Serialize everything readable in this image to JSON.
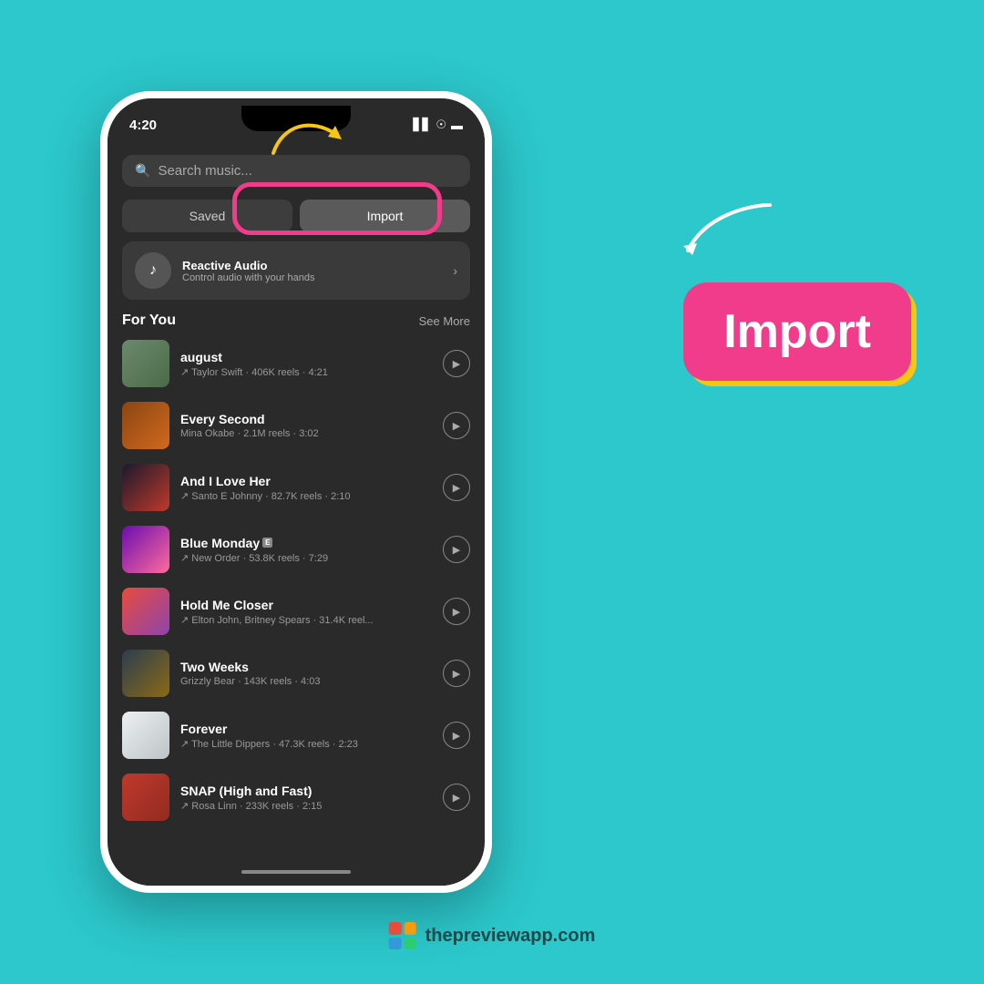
{
  "background_color": "#2cc8cc",
  "phone": {
    "status_bar": {
      "time": "4:20",
      "signal_icon": "▋▋",
      "wifi_icon": "WiFi",
      "battery_icon": "▬"
    },
    "search": {
      "placeholder": "Search music..."
    },
    "tabs": {
      "saved_label": "Saved",
      "import_label": "Import"
    },
    "reactive": {
      "title": "Reactive Audio",
      "subtitle": "Control audio with your hands"
    },
    "section": {
      "title": "For You",
      "see_more": "See More"
    },
    "songs": [
      {
        "title": "august",
        "meta": "↗ Taylor Swift · 406K reels · 4:21",
        "thumb_class": "thumb-august"
      },
      {
        "title": "Every Second",
        "meta": "Mina Okabe · 2.1M reels · 3:02",
        "thumb_class": "thumb-every-second"
      },
      {
        "title": "And I Love Her",
        "meta": "↗ Santo E Johnny · 82.7K reels · 2:10",
        "thumb_class": "thumb-and-i-love"
      },
      {
        "title": "Blue Monday",
        "meta": "↗ New Order · 53.8K reels · 7:29",
        "thumb_class": "thumb-blue-monday",
        "explicit": true
      },
      {
        "title": "Hold Me Closer",
        "meta": "↗ Elton John, Britney Spears · 31.4K reel...",
        "thumb_class": "thumb-hold-me"
      },
      {
        "title": "Two Weeks",
        "meta": "Grizzly Bear · 143K reels · 4:03",
        "thumb_class": "thumb-two-weeks"
      },
      {
        "title": "Forever",
        "meta": "↗ The Little Dippers · 47.3K reels · 2:23",
        "thumb_class": "thumb-forever"
      },
      {
        "title": "SNAP (High and Fast)",
        "meta": "↗ Rosa Linn · 233K reels · 2:15",
        "thumb_class": "thumb-snap"
      }
    ]
  },
  "import_badge": {
    "label": "Import"
  },
  "footer": {
    "website": "thepreviewapp.com"
  }
}
